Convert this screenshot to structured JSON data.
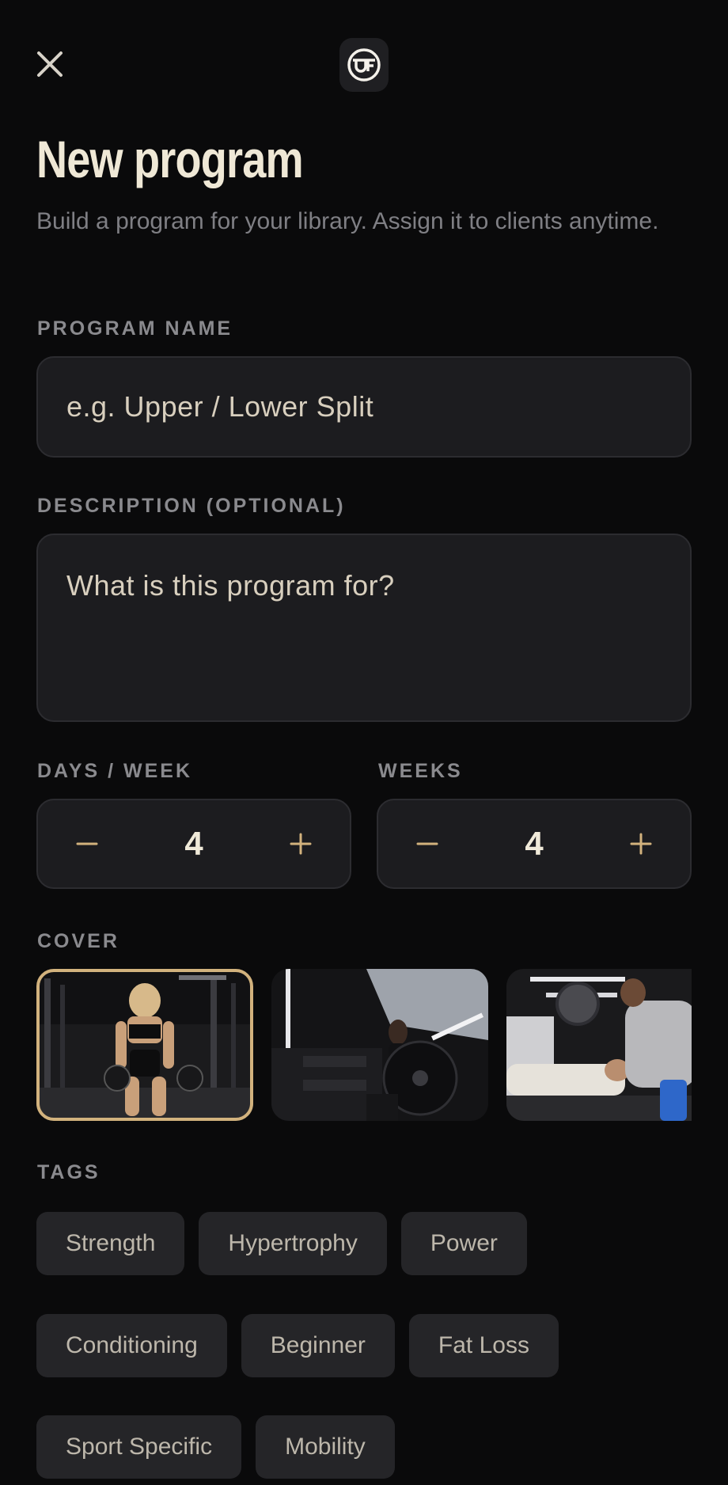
{
  "header": {
    "close_icon": "close-icon",
    "logo_icon": "brand-logo"
  },
  "title": "New program",
  "subtitle": "Build a program for your library. Assign it to clients anytime.",
  "form": {
    "program_name": {
      "label": "PROGRAM NAME",
      "placeholder": "e.g. Upper / Lower Split",
      "value": ""
    },
    "description": {
      "label": "DESCRIPTION (OPTIONAL)",
      "placeholder": "What is this program for?",
      "value": ""
    },
    "days_per_week": {
      "label": "DAYS / WEEK",
      "value": "4"
    },
    "weeks": {
      "label": "WEEKS",
      "value": "4"
    }
  },
  "cover": {
    "label": "COVER",
    "images": [
      {
        "name": "cover-woman-dumbbells",
        "selected": true
      },
      {
        "name": "cover-woman-york-plate",
        "selected": false
      },
      {
        "name": "cover-bench-press-spotter",
        "selected": false
      }
    ]
  },
  "tags": {
    "label": "TAGS",
    "rows": [
      [
        "Strength",
        "Hypertrophy",
        "Power"
      ],
      [
        "Conditioning",
        "Beginner",
        "Fat Loss"
      ],
      [
        "Sport Specific",
        "Mobility"
      ]
    ]
  },
  "colors": {
    "background": "#0a0a0b",
    "surface": "#1c1c1f",
    "accent": "#d2b27d",
    "chip": "#252528"
  }
}
